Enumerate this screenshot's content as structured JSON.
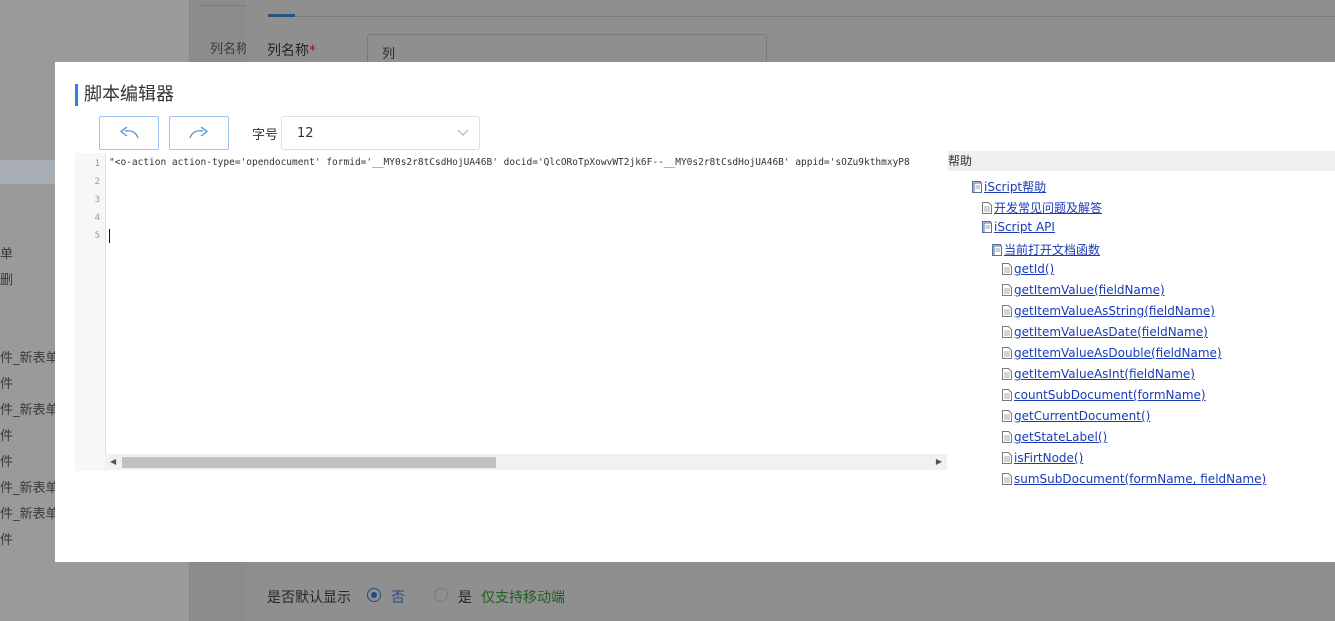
{
  "background": {
    "left_items": [
      "列名称",
      "单",
      "删",
      "件_新表单",
      "件",
      "件_新表单",
      "件",
      "件",
      "件_新表单",
      "件_新表单",
      "件"
    ],
    "column_name_label": "列名称",
    "column_name_value": "列",
    "default_display_label": "是否默认显示",
    "radio_no": "否",
    "radio_yes": "是",
    "mobile_only_note": "仅支持移动端"
  },
  "modal": {
    "title": "脚本编辑器",
    "undo_icon": "undo-arrow-icon",
    "redo_icon": "redo-arrow-icon",
    "font_size_label": "字号",
    "font_size_value": "12",
    "colors": {
      "accent": "#2f7ff0",
      "link": "#1a3ab8"
    }
  },
  "editor": {
    "line_numbers": [
      "1",
      "2",
      "3",
      "4",
      "5"
    ],
    "code_line_1": "\"<o-action action-type='opendocument' formid='__MY0s2r8tCsdHojUA46B' docid='QlcORoTpXowvWT2jk6F--__MY0s2r8tCsdHojUA46B' appid='sOZu9kthmxyP8"
  },
  "help": {
    "header": "帮助",
    "tree": [
      {
        "label": "iScript帮助",
        "icon": "book-icon"
      },
      {
        "label": "开发常见问题及解答",
        "icon": "doc-icon"
      },
      {
        "label": "iScript API",
        "icon": "book-icon"
      },
      {
        "label": "当前打开文档函数",
        "icon": "book-icon"
      },
      {
        "label": "getId()",
        "icon": "doc-icon"
      },
      {
        "label": "getItemValue(fieldName)",
        "icon": "doc-icon"
      },
      {
        "label": "getItemValueAsString(fieldName)",
        "icon": "doc-icon"
      },
      {
        "label": "getItemValueAsDate(fieldName)",
        "icon": "doc-icon"
      },
      {
        "label": "getItemValueAsDouble(fieldName)",
        "icon": "doc-icon"
      },
      {
        "label": "getItemValueAsInt(fieldName)",
        "icon": "doc-icon"
      },
      {
        "label": "countSubDocument(formName)",
        "icon": "doc-icon"
      },
      {
        "label": "getCurrentDocument()",
        "icon": "doc-icon"
      },
      {
        "label": "getStateLabel()",
        "icon": "doc-icon"
      },
      {
        "label": "isFirtNode()",
        "icon": "doc-icon"
      },
      {
        "label": "sumSubDocument(formName, fieldName)",
        "icon": "doc-icon"
      }
    ]
  }
}
